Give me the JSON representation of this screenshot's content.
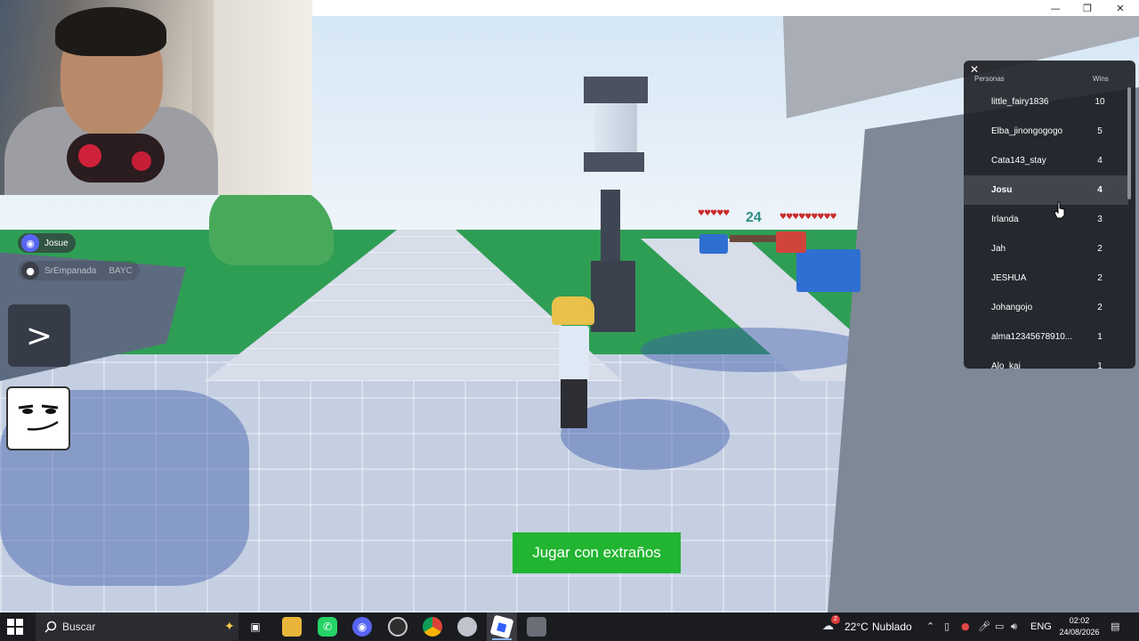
{
  "window": {
    "minimize_glyph": "—",
    "maximize_glyph": "❐",
    "close_glyph": "✕"
  },
  "overlay": {
    "players": [
      {
        "name": "Josue",
        "icon": "discord-icon"
      },
      {
        "name": "SrEmpanada",
        "tag": "BAYC",
        "icon": "avatar-icon"
      }
    ],
    "arrow_label": ">",
    "floating_number": "24"
  },
  "leaderboard": {
    "close_glyph": "✕",
    "col_name": "Personas",
    "col_wins": "Wins",
    "rows": [
      {
        "name": "little_fairy1836",
        "wins": "10"
      },
      {
        "name": "Elba_jinongogogo",
        "wins": "5"
      },
      {
        "name": "Cata143_stay",
        "wins": "4"
      },
      {
        "name": "Josu",
        "wins": "4"
      },
      {
        "name": "Irlanda",
        "wins": "3"
      },
      {
        "name": "Jah",
        "wins": "2"
      },
      {
        "name": "JESHUA",
        "wins": "2"
      },
      {
        "name": "Johangojo",
        "wins": "2"
      },
      {
        "name": "alma12345678910...",
        "wins": "1"
      },
      {
        "name": "Alo_kai",
        "wins": "1"
      }
    ]
  },
  "cta": {
    "label": "Jugar con extraños",
    "color": "#22b531"
  },
  "taskbar": {
    "search_placeholder": "Buscar",
    "weather_temp": "22°C",
    "weather_desc": "Nublado",
    "weather_badge": "2",
    "language": "ENG",
    "time": "02:02",
    "date": "24/08/2026",
    "apps": [
      "task-view-icon",
      "file-explorer-icon",
      "whatsapp-icon",
      "discord-icon",
      "obs-icon",
      "chrome-icon",
      "app-icon",
      "roblox-icon",
      "roblox-studio-icon"
    ]
  }
}
